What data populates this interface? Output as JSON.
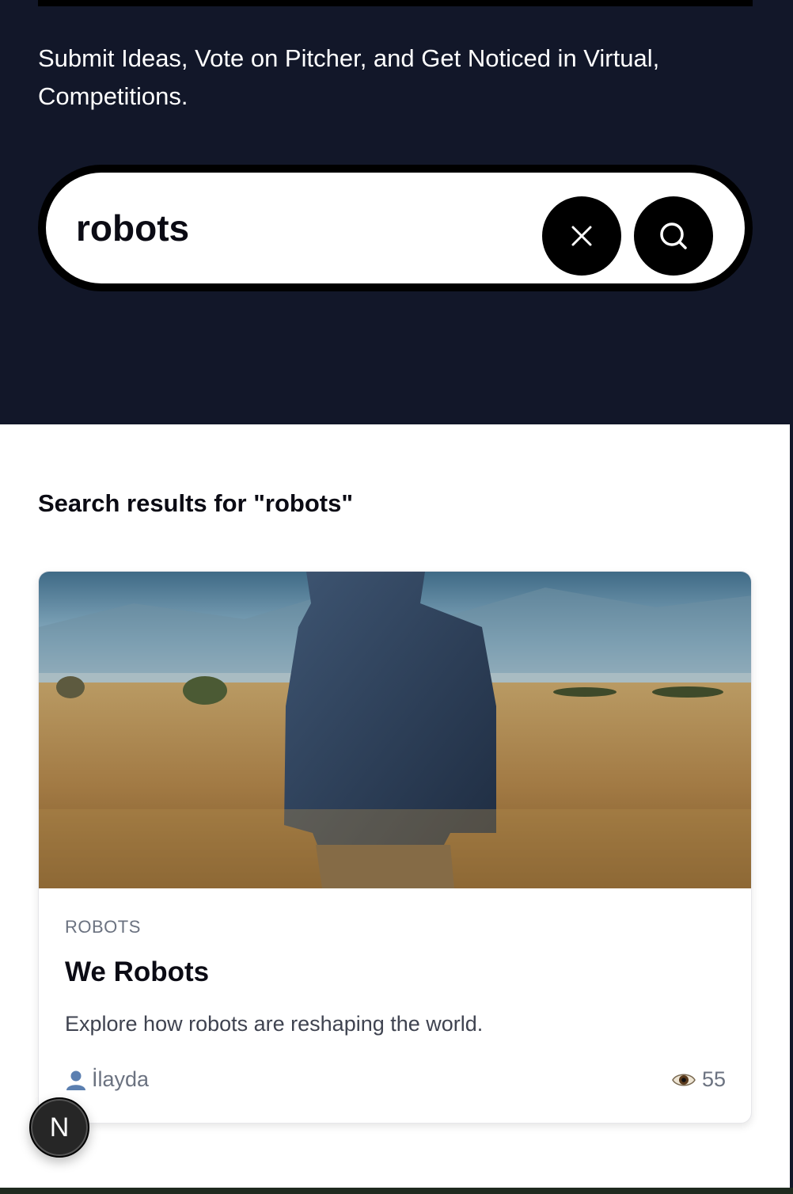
{
  "hero": {
    "subtitle": "Submit Ideas, Vote on Pitcher, and Get Noticed in Virtual, Competitions."
  },
  "search": {
    "query": "robots",
    "clear_icon": "close-icon",
    "submit_icon": "search-icon"
  },
  "results": {
    "heading": "Search results for \"robots\""
  },
  "startups": [
    {
      "category": "ROBOTS",
      "title": "We Robots",
      "description": "Explore how robots are reshaping the world.",
      "author": "İlayda",
      "author_icon": "user-icon",
      "views": "55",
      "views_icon": "eye-icon",
      "image": "person-in-jacket-in-wheat-field"
    }
  ],
  "dev_badge": {
    "label": "N"
  },
  "colors": {
    "hero_bg": "#121729",
    "search_border": "#000000",
    "card_border": "#e6e6ea",
    "muted_text": "#6b7280"
  }
}
